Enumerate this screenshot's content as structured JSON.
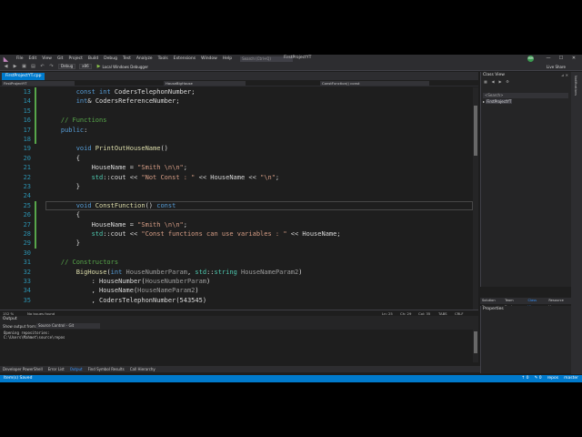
{
  "menu": [
    "File",
    "Edit",
    "View",
    "Git",
    "Project",
    "Build",
    "Debug",
    "Test",
    "Analyze",
    "Tools",
    "Extensions",
    "Window",
    "Help"
  ],
  "search_placeholder": "Search (Ctrl+Q)",
  "project_title": "FirstProjectYT",
  "avatar": "MM",
  "toolbar": {
    "config": "Debug",
    "platform": "x86",
    "run_label": "Local Windows Debugger",
    "live_share": "Live Share"
  },
  "doc_tab": "FirstProjectYT.cpp",
  "nav": {
    "scope": "FirstProjectYT",
    "class": "HouseBigHouse",
    "member": "ConstFunction() const"
  },
  "editor_lines": [
    {
      "n": "13",
      "html": "        <span class='kw'>const</span> <span class='kw'>int</span> <span class='mb'>CodersTelephonNumber</span>;"
    },
    {
      "n": "14",
      "html": "        <span class='kw'>int</span>&amp; <span class='mb'>CodersReferenceNumber</span>;"
    },
    {
      "n": "15",
      "html": ""
    },
    {
      "n": "16",
      "html": "    <span class='cm'>// Functions</span>"
    },
    {
      "n": "17",
      "html": "    <span class='kw'>public</span>:"
    },
    {
      "n": "18",
      "html": ""
    },
    {
      "n": "19",
      "html": "        <span class='kw'>void</span> <span class='fn'>PrintOutHouseName</span>()"
    },
    {
      "n": "20",
      "html": "        {"
    },
    {
      "n": "21",
      "html": "            <span class='mb'>HouseName</span> = <span class='st'>\"Smith \\n\\n\"</span>;"
    },
    {
      "n": "22",
      "html": "            <span class='ty'>std</span>::<span class='mb'>cout</span> &lt;&lt; <span class='st'>\"Not Const : \"</span> &lt;&lt; <span class='mb'>HouseName</span> &lt;&lt; <span class='st'>\"\\n\"</span>;"
    },
    {
      "n": "23",
      "html": "        }"
    },
    {
      "n": "24",
      "html": ""
    },
    {
      "n": "25",
      "html": "        <span class='kw'>void</span> <span class='fn'>ConstFunction</span>() <span class='kw'>const</span>"
    },
    {
      "n": "26",
      "html": "        {"
    },
    {
      "n": "27",
      "html": "            <span class='mb'>HouseName</span> = <span class='st'>\"Smith \\n\\n\"</span>;"
    },
    {
      "n": "28",
      "html": "            <span class='ty'>std</span>::<span class='mb'>cout</span> &lt;&lt; <span class='st'>\"Const functions can use variables : \"</span> &lt;&lt; <span class='mb'>HouseName</span>;"
    },
    {
      "n": "29",
      "html": "        }"
    },
    {
      "n": "30",
      "html": ""
    },
    {
      "n": "31",
      "html": "    <span class='cm'>// Constructors</span>"
    },
    {
      "n": "32",
      "html": "        <span class='fn'>BigHouse</span>(<span class='kw'>int</span> <span class='pm'>HouseNumberParam</span>, <span class='ty'>std</span>::<span class='ty'>string</span> <span class='pm'>HouseNameParam2</span>)"
    },
    {
      "n": "33",
      "html": "            : <span class='mb'>HouseNumber</span>(<span class='pm'>HouseNumberParam</span>)"
    },
    {
      "n": "34",
      "html": "            , <span class='mb'>HouseName</span>(<span class='pm'>HouseNameParam2</span>)"
    },
    {
      "n": "35",
      "html": "            , <span class='mb'>CodersTelephonNumber</span>(543545)"
    }
  ],
  "editor_status": {
    "zoom": "152 %",
    "issues": "No issues found",
    "ln": "Ln: 25",
    "ch": "Ch: 29",
    "col": "Col: 35",
    "tabs": "TABS",
    "crlf": "CRLF"
  },
  "output": {
    "title": "Output",
    "from_label": "Show output from:",
    "source": "Source Control - Git",
    "lines": [
      "Opening repositories:",
      "C:\\Users\\Mahmet\\source\\repos"
    ]
  },
  "bottom_tabs": [
    "Developer PowerShell",
    "Error List",
    "Output",
    "Find Symbol Results",
    "Call Hierarchy"
  ],
  "status": {
    "left": "Item(s) Saved",
    "right": [
      "↑ 0",
      "✎ 0",
      "repos",
      "master"
    ]
  },
  "classview": {
    "title": "Class View",
    "search": "<Search>",
    "item": "FirstProjectYT"
  },
  "cv_tabs": [
    "Solution E...",
    "Team Expl...",
    "Class View",
    "Resource V..."
  ],
  "props_title": "Properties",
  "right_strip": "Notifications"
}
